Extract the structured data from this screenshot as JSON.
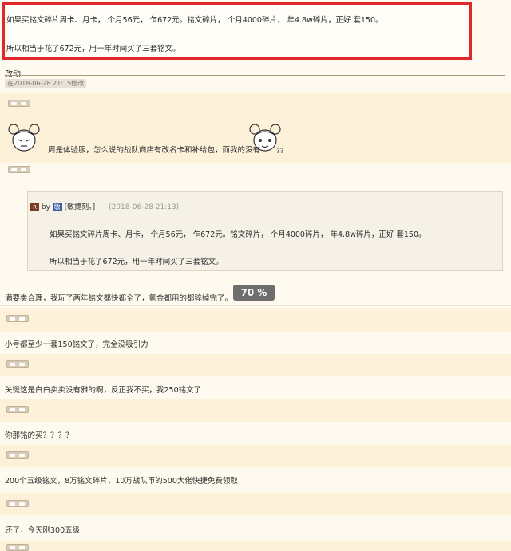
{
  "highlight": {
    "line1": "如果买铭文碎片周卡、月卡，    个月56元，    乍672元。铭文碎片，    个月4000碎片，    年4.8w碎片，正好    套150。",
    "line2": "所以相当于花了672元，用一年时间买了三套铭文。"
  },
  "edit": {
    "heading": "改动",
    "stamp": "在2018-06-28 21:15修改"
  },
  "post": {
    "text": "周是体验服，怎么说的战队商店有改名卡和补给包，而我的没有"
  },
  "quote": {
    "user": "[敏捷刻。]",
    "timestamp": "(2018-06-28 21:13)",
    "line1": "如果买铭文碎片周卡、月卡，    个月56元，    乍672元。铭文碎片，    个月4000碎片，    年4.8w碎片，正好    套150。",
    "line2": "所以相当于花了672元，用一年时间买了三套铭文。"
  },
  "reply_after_quote": "满要卖合理，我玩了两年铭文都快都全了，氪金都用的都猝掉完了。",
  "progress_badge": "70 %",
  "comments": [
    "小号都至少一套150铭文了，完全没吸引力",
    "关键这是白白卖卖没有雅的啊，反正我不买，我250铭文了",
    "你那铭的买？？？？",
    "200个五级铭文，8万铭文碎片，10万战队币的500大佬快捷免费领取",
    "还了，今天刚300五级"
  ]
}
